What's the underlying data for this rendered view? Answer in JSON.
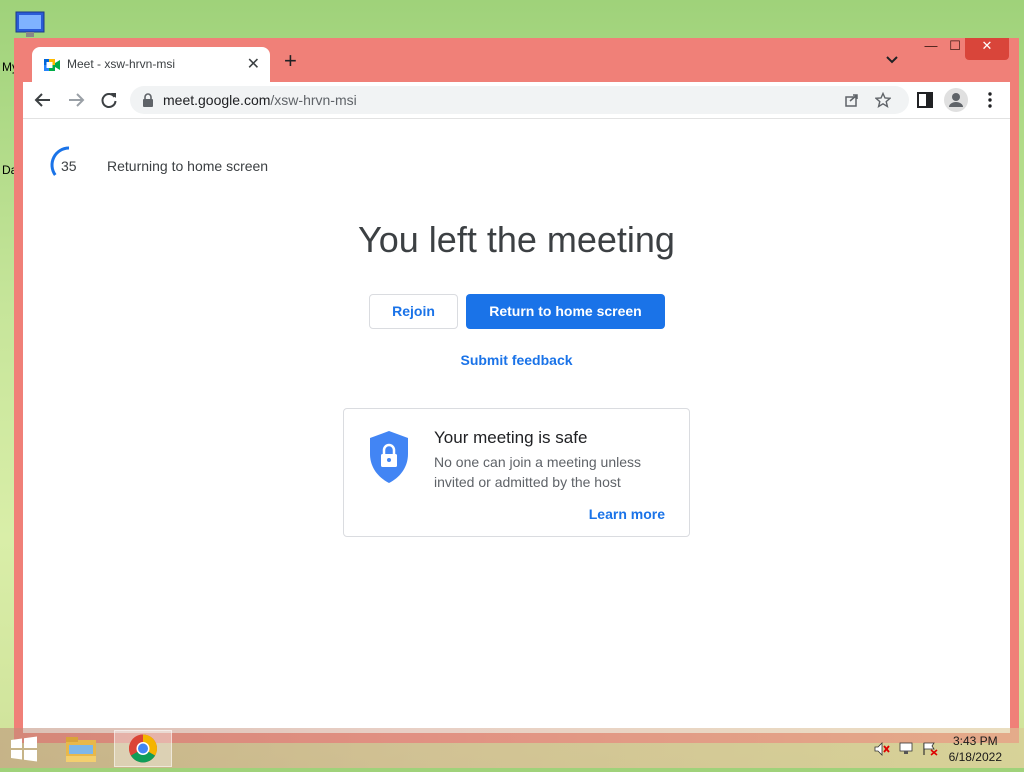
{
  "desktop": {
    "icon_labels": [
      "My",
      "Da"
    ]
  },
  "browser": {
    "tab_title": "Meet - xsw-hrvn-msi",
    "tab_close": "✕",
    "new_tab": "+",
    "url_host": "meet.google.com",
    "url_path": "/xsw-hrvn-msi",
    "window_min": "—",
    "window_max": "☐",
    "window_close": "✕"
  },
  "page": {
    "countdown": "35",
    "countdown_fraction": 0.35,
    "returning_text": "Returning to home screen",
    "headline": "You left the meeting",
    "rejoin_label": "Rejoin",
    "return_label": "Return to home screen",
    "feedback_label": "Submit feedback",
    "card": {
      "title": "Your meeting is safe",
      "text": "No one can join a meeting unless invited or admitted by the host",
      "learn_more": "Learn more"
    }
  },
  "taskbar": {
    "time": "3:43 PM",
    "date": "6/18/2022"
  },
  "colors": {
    "accent": "#1a73e8",
    "window_frame": "#f08078",
    "close_button": "#d9453a"
  }
}
